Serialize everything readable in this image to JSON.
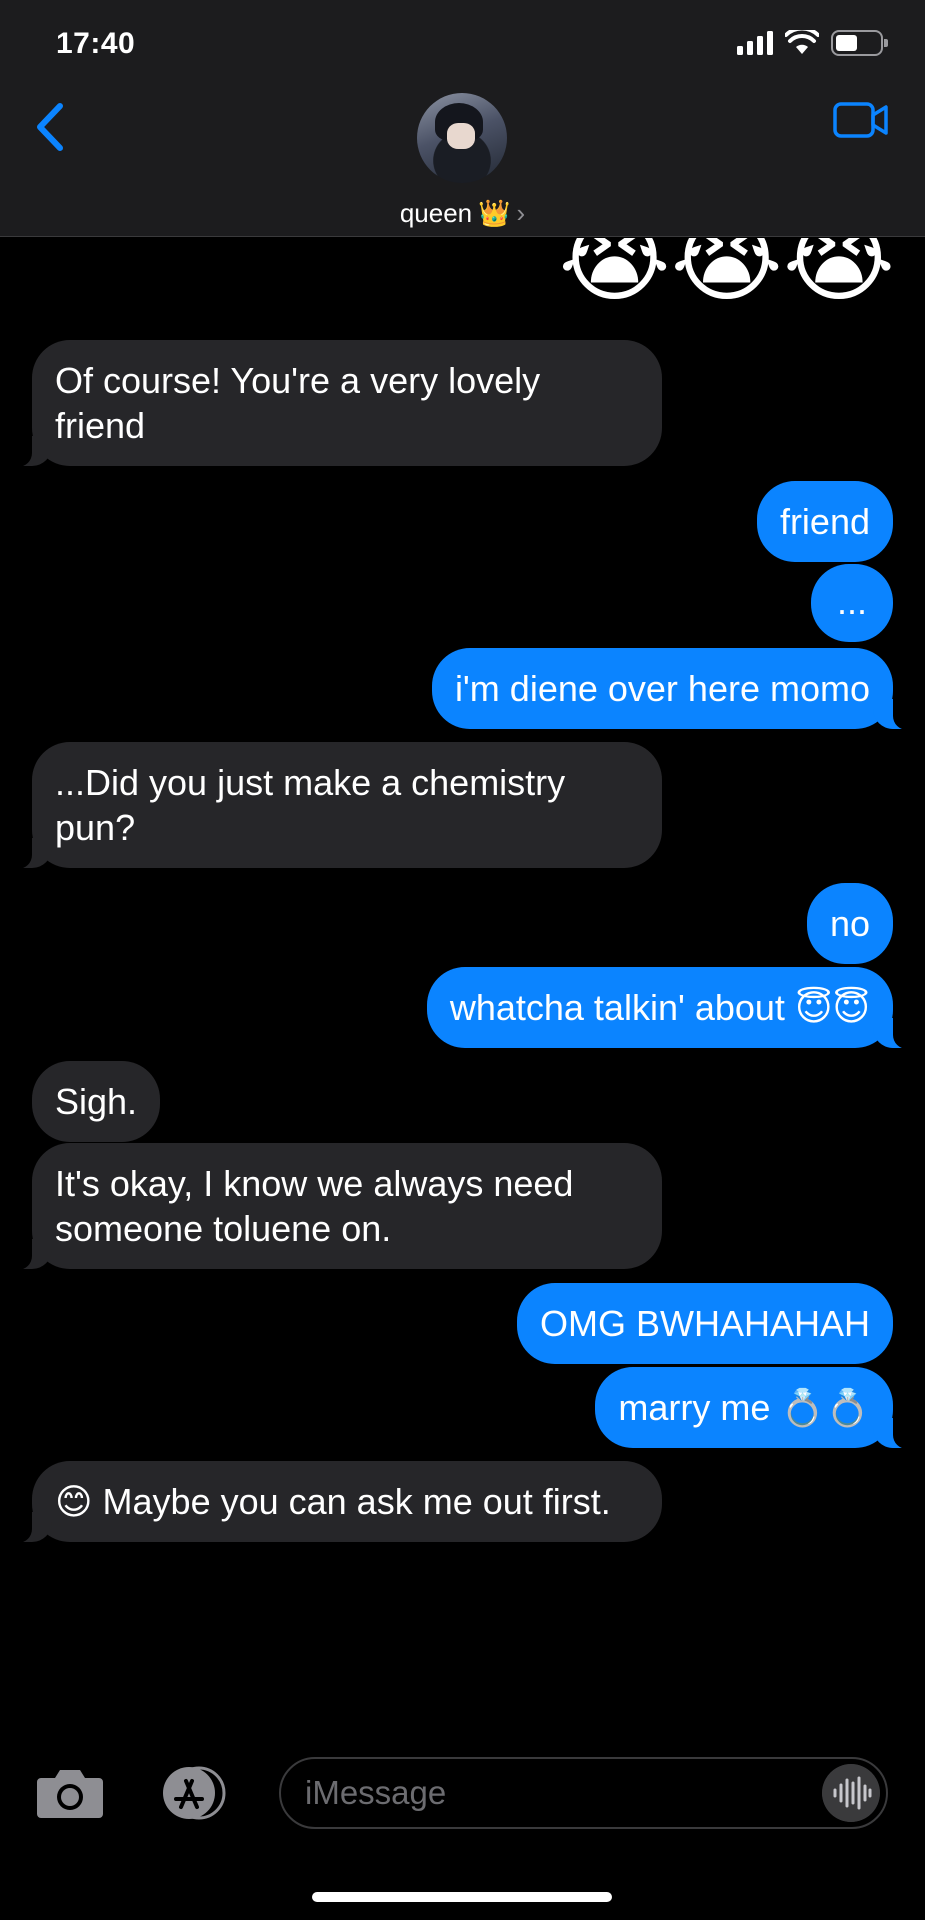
{
  "status_bar": {
    "time": "17:40",
    "battery_level": 0.5,
    "signal_bars": 4,
    "icons": [
      "cellular-signal-icon",
      "wifi-icon",
      "battery-icon"
    ]
  },
  "header": {
    "contact_name": "queen",
    "contact_emoji": "👑",
    "chevron": "›",
    "icons": [
      "back-chevron-icon",
      "video-call-icon",
      "avatar"
    ]
  },
  "colors": {
    "header_bg": "#1c1c1e",
    "incoming_bubble": "#262629",
    "outgoing_bubble": "#0b84ff",
    "accent": "#0b84ff",
    "background": "#000000"
  },
  "messages": {
    "m0_emoji": "😭😭😭",
    "m1": "Of course! You're a very lovely friend",
    "m2": "friend",
    "m3": "...",
    "m4": "i'm diene over here momo",
    "m5": "...Did you just make a chemistry pun?",
    "m6": "no",
    "m7": "whatcha talkin' about 😇😇",
    "m8": "Sigh.",
    "m9": "It's okay, I know we always need someone toluene on.",
    "m10": "OMG BWHAHAHAH",
    "m11": "marry me 💍💍",
    "m12": "😊 Maybe you can ask me out first."
  },
  "compose": {
    "placeholder": "iMessage",
    "icons": [
      "camera-icon",
      "app-store-icon",
      "audio-waveform-icon"
    ]
  }
}
